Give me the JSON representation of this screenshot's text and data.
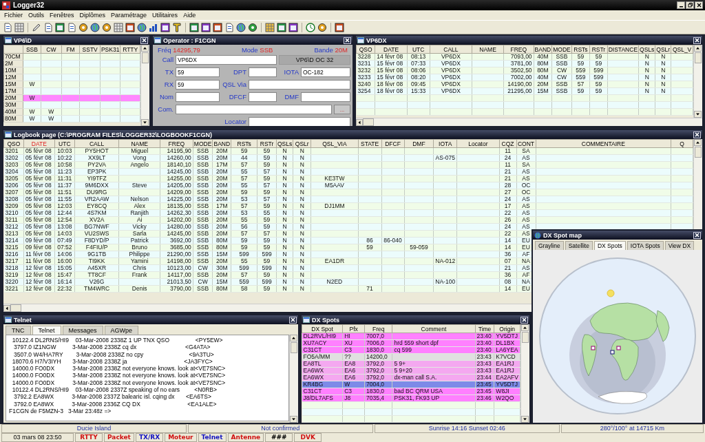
{
  "app": {
    "title": "Logger32"
  },
  "menu": [
    "Fichier",
    "Outils",
    "Fenêtres",
    "Diplômes",
    "Paramétrage",
    "Utilitaires",
    "Aide"
  ],
  "band_grid": {
    "title": "VP6\\D",
    "columns": [
      "SSB",
      "CW",
      "FM",
      "SSTV",
      "PSK31",
      "RTTY"
    ],
    "rows": [
      {
        "band": "70CM",
        "cells": [],
        "selected": false
      },
      {
        "band": "2M",
        "cells": [],
        "selected": false
      },
      {
        "band": "10M",
        "cells": [],
        "selected": false
      },
      {
        "band": "12M",
        "cells": [],
        "selected": false
      },
      {
        "band": "15M",
        "cells": [
          "W"
        ],
        "selected": false
      },
      {
        "band": "17M",
        "cells": [],
        "selected": false
      },
      {
        "band": "20M",
        "cells": [
          "W"
        ],
        "selected": true
      },
      {
        "band": "30M",
        "cells": [],
        "selected": false
      },
      {
        "band": "40M",
        "cells": [
          "W",
          "W"
        ],
        "selected": false
      },
      {
        "band": "80M",
        "cells": [
          "W",
          "W"
        ],
        "selected": false
      }
    ]
  },
  "operator": {
    "title": "Operator : F1CGN",
    "readouts": [
      {
        "label": "Fréq",
        "value": "14295,79"
      },
      {
        "label": "Mode",
        "value": "SSB"
      },
      {
        "label": "Bande",
        "value": "20M"
      }
    ],
    "call": {
      "label": "Call",
      "value": "VP6DX"
    },
    "entity": "VP6\\D  OC 32",
    "tx": {
      "label": "TX",
      "value": "59"
    },
    "dpt": {
      "label": "DPT"
    },
    "iota": {
      "label": "IOTA",
      "value": "OC-182"
    },
    "rx": {
      "label": "RX",
      "value": "59"
    },
    "qsl_via": {
      "label": "QSL Via"
    },
    "nom": {
      "label": "Nom"
    },
    "dfcf": {
      "label": "DFCF"
    },
    "dmf": {
      "label": "DMF"
    },
    "com": {
      "label": "Com."
    },
    "com_button": "...",
    "locator": {
      "label": "Locator"
    }
  },
  "station_log": {
    "title": "VP6DX",
    "columns": [
      "QSO",
      "DATE",
      "UTC",
      "CALL",
      "NAME",
      "FREQ",
      "BAND",
      "MODE",
      "RSTs",
      "RSTr",
      "DISTANCE",
      "QSLs",
      "QSLr",
      "QSL_V"
    ],
    "rows": [
      [
        "3228",
        "14 févr 08",
        "08:13",
        "VP6DX",
        null,
        "7093,00",
        "40M",
        "SSB",
        "59",
        "59",
        null,
        "N",
        "N"
      ],
      [
        "3231",
        "15 févr 08",
        "07:33",
        "VP6DX",
        null,
        "3781,00",
        "80M",
        "SSB",
        "59",
        "59",
        null,
        "N",
        "N"
      ],
      [
        "3232",
        "15 févr 08",
        "08:06",
        "VP6DX",
        null,
        "3502,50",
        "80M",
        "CW",
        "559",
        "599",
        null,
        "N",
        "N"
      ],
      [
        "3233",
        "15 févr 08",
        "08:20",
        "VP6DX",
        null,
        "7002,00",
        "40M",
        "CW",
        "559",
        "599",
        null,
        "N",
        "N"
      ],
      [
        "3240",
        "18 févr 08",
        "09:45",
        "VP6DX",
        null,
        "14190,00",
        "20M",
        "SSB",
        "57",
        "59",
        null,
        "N",
        "N"
      ],
      [
        "3254",
        "18 févr 08",
        "15:33",
        "VP6DX",
        null,
        "21295,00",
        "15M",
        "SSB",
        "59",
        "59",
        null,
        "N",
        "N"
      ]
    ]
  },
  "logbook": {
    "title": "Logbook page (C:\\PROGRAM FILES\\LOGGER32\\LOGBOOKF1CGN)",
    "columns": [
      {
        "label": "QSO",
        "sorted": false
      },
      {
        "label": "DATE",
        "sorted": true
      },
      {
        "label": "UTC",
        "sorted": false
      },
      {
        "label": "CALL",
        "sorted": false
      },
      {
        "label": "NAME",
        "sorted": false
      },
      {
        "label": "FREQ",
        "sorted": false
      },
      {
        "label": "MODE",
        "sorted": false
      },
      {
        "label": "BAND",
        "sorted": false
      },
      {
        "label": "RSTs",
        "sorted": false
      },
      {
        "label": "RSTr",
        "sorted": false
      },
      {
        "label": "QSLs",
        "sorted": false
      },
      {
        "label": "QSLr",
        "sorted": false
      },
      {
        "label": "QSL_VIA",
        "sorted": false
      },
      {
        "label": "STATE",
        "sorted": false
      },
      {
        "label": "DFCF",
        "sorted": false
      },
      {
        "label": "DMF",
        "sorted": false
      },
      {
        "label": "IOTA",
        "sorted": false
      },
      {
        "label": "Locator",
        "sorted": false
      },
      {
        "label": "CQZ",
        "sorted": false
      },
      {
        "label": "CONT",
        "sorted": false
      },
      {
        "label": "COMMENTAIRE",
        "sorted": false
      },
      {
        "label": "Q",
        "sorted": false
      }
    ],
    "rows": [
      [
        "3201",
        "05 févr 08",
        "10:03",
        "PY5HOT",
        "Miguel",
        "14195,90",
        "SSB",
        "20M",
        "59",
        "59",
        "N",
        "N",
        null,
        null,
        null,
        null,
        null,
        null,
        "11",
        "SA"
      ],
      [
        "3202",
        "05 févr 08",
        "10:22",
        "XX9LT",
        "Vong",
        "14260,00",
        "SSB",
        "20M",
        "44",
        "59",
        "N",
        "N",
        null,
        null,
        null,
        null,
        "AS-075",
        null,
        "24",
        "AS"
      ],
      [
        "3203",
        "05 févr 08",
        "10:58",
        "PY2VA",
        "Angelo",
        "18140,10",
        "SSB",
        "17M",
        "57",
        "59",
        "N",
        "N",
        null,
        null,
        null,
        null,
        null,
        null,
        "11",
        "SA"
      ],
      [
        "3204",
        "05 févr 08",
        "11:23",
        "EP3PK",
        null,
        "14245,00",
        "SSB",
        "20M",
        "55",
        "57",
        "N",
        "N",
        null,
        null,
        null,
        null,
        null,
        null,
        "21",
        "AS"
      ],
      [
        "3205",
        "05 févr 08",
        "11:31",
        "YI9TFZ",
        null,
        "14255,00",
        "SSB",
        "20M",
        "57",
        "59",
        "N",
        "N",
        "KE3TW",
        null,
        null,
        null,
        null,
        null,
        "21",
        "AS"
      ],
      [
        "3206",
        "05 févr 08",
        "11:37",
        "9M6DXX",
        "Steve",
        "14205,00",
        "SSB",
        "20M",
        "55",
        "57",
        "N",
        "N",
        "M5AAV",
        null,
        null,
        null,
        null,
        null,
        "28",
        "OC"
      ],
      [
        "3207",
        "05 févr 08",
        "11:51",
        "DU9RG",
        null,
        "14209,00",
        "SSB",
        "20M",
        "59",
        "59",
        "N",
        "N",
        null,
        null,
        null,
        null,
        null,
        null,
        "27",
        "OC"
      ],
      [
        "3208",
        "05 févr 08",
        "11:55",
        "VR2AAW",
        "Nelson",
        "14225,00",
        "SSB",
        "20M",
        "53",
        "57",
        "N",
        "N",
        null,
        null,
        null,
        null,
        null,
        null,
        "24",
        "AS"
      ],
      [
        "3209",
        "05 févr 08",
        "12:03",
        "EY8CQ",
        "Alex",
        "18135,00",
        "SSB",
        "17M",
        "57",
        "59",
        "N",
        "N",
        "DJ1MM",
        null,
        null,
        null,
        null,
        null,
        "17",
        "AS"
      ],
      [
        "3210",
        "05 févr 08",
        "12:44",
        "4S7KM",
        "Ranjith",
        "14262,30",
        "SSB",
        "20M",
        "53",
        "55",
        "N",
        "N",
        null,
        null,
        null,
        null,
        null,
        null,
        "22",
        "AS"
      ],
      [
        "3211",
        "05 févr 08",
        "12:54",
        "XV2A",
        "Ai",
        "14202,00",
        "SSB",
        "20M",
        "55",
        "59",
        "N",
        "N",
        null,
        null,
        null,
        null,
        null,
        null,
        "26",
        "AS"
      ],
      [
        "3212",
        "05 févr 08",
        "13:08",
        "BG7NWF",
        "Vicky",
        "14280,00",
        "SSB",
        "20M",
        "56",
        "59",
        "N",
        "N",
        null,
        null,
        null,
        null,
        null,
        null,
        "24",
        "AS"
      ],
      [
        "3213",
        "05 févr 08",
        "14:03",
        "VU2SWS",
        "Sarla",
        "14245,00",
        "SSB",
        "20M",
        "57",
        "57",
        "N",
        "N",
        null,
        null,
        null,
        null,
        null,
        null,
        "22",
        "AS"
      ],
      [
        "3214",
        "09 févr 08",
        "07:49",
        "F8DYD/P",
        "Patrick",
        "3692,00",
        "SSB",
        "80M",
        "59",
        "59",
        "N",
        "N",
        null,
        "86",
        "86-040",
        null,
        null,
        null,
        "14",
        "EU"
      ],
      [
        "3215",
        "09 févr 08",
        "07:52",
        "F4FIU/P",
        "Bruno",
        "3685,00",
        "SSB",
        "80M",
        "59",
        "59",
        "N",
        "N",
        null,
        "59",
        null,
        "59-059",
        null,
        null,
        "14",
        "EU"
      ],
      [
        "3216",
        "11 févr 08",
        "14:06",
        "9G1TB",
        "Philippe",
        "21290,00",
        "SSB",
        "15M",
        "599",
        "599",
        "N",
        "N",
        null,
        null,
        null,
        null,
        null,
        null,
        "36",
        "AF"
      ],
      [
        "3217",
        "11 févr 08",
        "16:00",
        "TI9KK",
        "Yamini",
        "14198,00",
        "SSB",
        "20M",
        "55",
        "59",
        "N",
        "N",
        "EA1DR",
        null,
        null,
        null,
        "NA-012",
        null,
        "07",
        "NA"
      ],
      [
        "3218",
        "12 févr 08",
        "15:05",
        "A45XR",
        "Chris",
        "10123,00",
        "CW",
        "30M",
        "599",
        "599",
        "N",
        "N",
        null,
        null,
        null,
        null,
        null,
        null,
        "21",
        "AS"
      ],
      [
        "3219",
        "12 févr 08",
        "15:47",
        "TT8CF",
        "Frank",
        "14117,00",
        "SSB",
        "20M",
        "57",
        "59",
        "N",
        "N",
        null,
        null,
        null,
        null,
        null,
        null,
        "36",
        "AF"
      ],
      [
        "3220",
        "12 févr 08",
        "16:14",
        "V26G",
        null,
        "21013,50",
        "CW",
        "15M",
        "559",
        "599",
        "N",
        "N",
        "N2ED",
        null,
        null,
        null,
        "NA-100",
        null,
        "08",
        "NA"
      ],
      [
        "3221",
        "12 févr 08",
        "22:32",
        "TM4WRC",
        "Denis",
        "3790,00",
        "SSB",
        "80M",
        "58",
        "59",
        "N",
        "N",
        null,
        "71",
        null,
        null,
        null,
        null,
        "14",
        "EU"
      ]
    ]
  },
  "telnet": {
    "title": "Telnet",
    "tabs": [
      {
        "label": "TNC",
        "selected": false
      },
      {
        "label": "Telnet",
        "selected": true
      },
      {
        "label": "Messages",
        "selected": false
      },
      {
        "label": "AGWpe",
        "selected": false
      }
    ],
    "lines": [
      "  10122.4 DL2RNS/HI9    03-Mar-2008 2338Z 1 UP TNX QSO                <PY5EW>",
      "   3797.0 IZ1NGW          3-Mar-2008 2338Z cq dx                              <G4ATA>",
      "   3507.0 W4/HA7RY        3-Mar-2008 2338Z no cpy                            <9A3TU>",
      "  18070.6 H7/V3IYH       3-Mar-2008 2338Z ja                                   <JA3FYC>",
      "  14000.0 FO0DX           3-Mar-2008 2338Z not everyone knows. look at<VE7SNC>",
      "  14000.0 FO0DX           3-Mar-2008 2338Z not everyone knows. look at<VE7SNC>",
      "  14000.0 FO0DX           3-Mar-2008 2338Z not everyone knows. look at<VE7SNC>",
      "  10122.4 DL2RNS/HI9    03-Mar-2008 2337Z speaking of no ears         <N0RB>",
      "   3792.2 EA8WX           3-Mar-2008 2337Z balearic isl. cqing dx       <EA6TS>",
      "   3792.0 EA8WX           3-Mar-2008 2336Z CQ DX                             <EA1ALE>",
      "F1CGN de F5MZN-3   3-Mar 23:48z =>"
    ]
  },
  "dx_spots": {
    "title": "DX Spots",
    "columns": [
      "DX Spot",
      "Pfx",
      "Freq",
      "Comment",
      "Time",
      "Origin"
    ],
    "rows": [
      {
        "cells": [
          "DL2RVL/HI9",
          "HI",
          "7007,0",
          null,
          "23:40",
          "YV5DTJ"
        ],
        "color": "#ff80ff"
      },
      {
        "cells": [
          "XU7ACY",
          "XU",
          "7006,0",
          "hrd 559 short dpf",
          "23:40",
          "DL1BX"
        ],
        "color": "#ff80ff"
      },
      {
        "cells": [
          "C31CT",
          "C3",
          "1830,0",
          "cq 599",
          "23:40",
          "LA6YEA"
        ],
        "color": "#ff80ff"
      },
      {
        "cells": [
          "FO5A/MM",
          "??",
          "14200,0",
          null,
          "23:43",
          "K7VCD"
        ],
        "color": "#e0e0e0"
      },
      {
        "cells": [
          "EA8TL",
          "EA8",
          "3792,0",
          "5 9+",
          "23:43",
          "EA1RJ"
        ],
        "color": "#f4a8f0"
      },
      {
        "cells": [
          "EA6WX",
          "EA6",
          "3792,0",
          "5 9+20",
          "23:43",
          "EA1RJ"
        ],
        "color": "#f4a8f0"
      },
      {
        "cells": [
          "EA6WX",
          "EA6",
          "3792,0",
          "dx-man call S.A.",
          "23:44",
          "EA2AFV"
        ],
        "color": "#f4a8f0"
      },
      {
        "cells": [
          "KR4BG",
          "W",
          "7004,0",
          null,
          "23:45",
          "YV5DTJ"
        ],
        "color": "#7d8ae8"
      },
      {
        "cells": [
          "C31CT",
          "C3",
          "1830,0",
          "bad BC QRM USA",
          "23:45",
          "W8JI"
        ],
        "color": "#ff80ff"
      },
      {
        "cells": [
          "J8/DL7AFS",
          "J8",
          "7035,4",
          "PSK31, FK93 UP",
          "23:46",
          "W2QO"
        ],
        "color": "#ff80ff"
      }
    ]
  },
  "dx_map": {
    "title": "DX Spot map",
    "tabs": [
      {
        "label": "Grayline",
        "selected": false
      },
      {
        "label": "Satellite",
        "selected": false
      },
      {
        "label": "DX Spots",
        "selected": true
      },
      {
        "label": "IOTA Spots",
        "selected": false
      },
      {
        "label": "View DX",
        "selected": false
      }
    ]
  },
  "status_bar": {
    "fields": [
      "Ducie Island",
      "Not confirmed",
      "Sunrise 14:16 Sunset 02:46",
      "280°/100° at  14715 Km"
    ],
    "clock": "03 mars 08  23:50",
    "indicators": [
      {
        "label": "RTTY",
        "color": "#d01010"
      },
      {
        "label": "Packet",
        "color": "#d01010"
      },
      {
        "label": "TX/RX",
        "color": "#1010c0"
      },
      {
        "label": "Moteur",
        "color": "#d01010"
      },
      {
        "label": "Telnet",
        "color": "#1010c0"
      },
      {
        "label": "Antenne",
        "color": "#d01010"
      },
      {
        "label": "###",
        "color": "#000000"
      },
      {
        "label": "DVK",
        "color": "#d01010"
      }
    ]
  }
}
